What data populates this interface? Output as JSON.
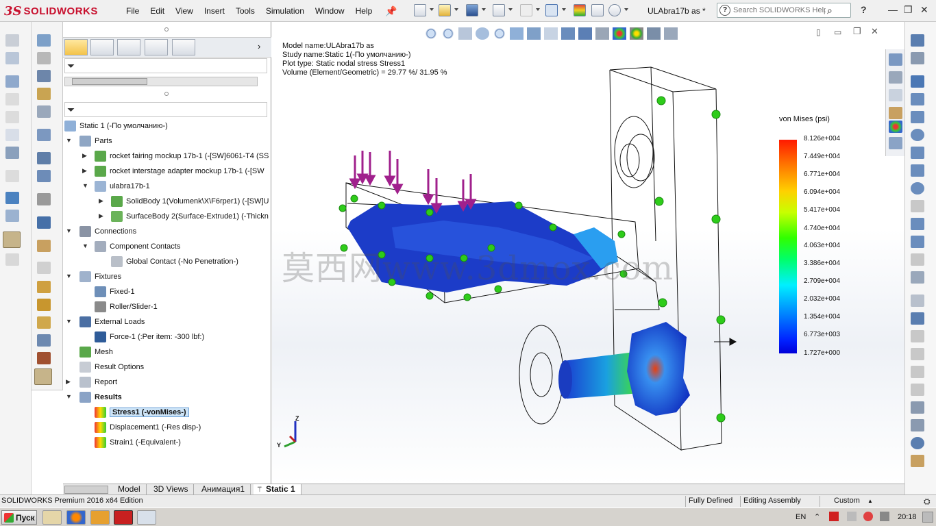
{
  "app": {
    "brand_ds": "3S",
    "brand_name": "SOLIDWORKS",
    "doc_title": "ULAbra17b as *"
  },
  "menu": [
    "File",
    "Edit",
    "View",
    "Insert",
    "Tools",
    "Simulation",
    "Window",
    "Help"
  ],
  "search": {
    "placeholder": "Search SOLIDWORKS Help"
  },
  "tree": {
    "root": "Static 1 (-По умолчанию-)",
    "parts": "Parts",
    "part1": "rocket fairing mockup 17b-1 (-[SW]6061-T4 (SS",
    "part2": "rocket interstage adapter mockup 17b-1 (-[SW",
    "part3": "ulabra17b-1",
    "body1": "SolidBody 1(Volumenk\\X\\F6rper1) (-[SW]U",
    "body2": "SurfaceBody 2(Surface-Extrude1) (-Thickn",
    "connections": "Connections",
    "component_contacts": "Component Contacts",
    "global_contact": "Global Contact (-No Penetration-)",
    "fixtures": "Fixtures",
    "fixed1": "Fixed-1",
    "roller": "Roller/Slider-1",
    "external_loads": "External Loads",
    "force1": "Force-1 (:Per item: -300 lbf:)",
    "mesh": "Mesh",
    "result_options": "Result Options",
    "report": "Report",
    "results": "Results",
    "stress1": "Stress1 (-vonMises-)",
    "displacement1": "Displacement1 (-Res disp-)",
    "strain1": "Strain1 (-Equivalent-)"
  },
  "bottom_tabs": [
    "Model",
    "3D Views",
    "Анимация1",
    "Static 1"
  ],
  "study": {
    "line1": "Model name:ULAbra17b as",
    "line2": "Study name:Static 1(-По умолчанию-)",
    "line3": "Plot type: Static nodal stress Stress1",
    "line4": "Volume (Element/Geometric) = 29.77 %/ 31.95 %"
  },
  "legend": {
    "title": "von Mises (psi)",
    "labels": [
      "8.126e+004",
      "7.449e+004",
      "6.771e+004",
      "6.094e+004",
      "5.417e+004",
      "4.740e+004",
      "4.063e+004",
      "3.386e+004",
      "2.709e+004",
      "2.032e+004",
      "1.354e+004",
      "6.773e+003",
      "1.727e+000"
    ]
  },
  "triad": {
    "z": "Z",
    "y": "Y"
  },
  "watermark": "莫西网www.3dmox.com",
  "status": {
    "edition": "SOLIDWORKS Premium 2016 x64 Edition",
    "defined": "Fully Defined",
    "editing": "Editing Assembly",
    "units": "Custom"
  },
  "taskbar": {
    "start": "Пуск",
    "lang": "EN",
    "clock": "20:18"
  },
  "colors": {
    "brand": "#c8102e",
    "mesh_blue": "#1c3cc8",
    "arrow_magenta": "#a0208c",
    "fixture_green": "#2ecc1a"
  }
}
